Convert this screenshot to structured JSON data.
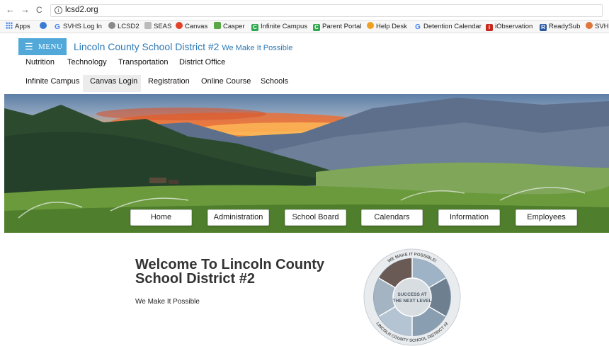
{
  "browser": {
    "back_glyph": "←",
    "forward_glyph": "→",
    "reload_glyph": "C",
    "info_glyph": "i",
    "url": "lcsd2.org",
    "bookmarks": [
      {
        "label": "Apps",
        "icon": "apps-grid-icon"
      },
      {
        "label": "",
        "icon": "blue-globe-icon",
        "color": "#3a7bd5"
      },
      {
        "label": "SVHS Log In",
        "icon": "google-icon",
        "glyph": "G",
        "color": "#4285f4"
      },
      {
        "label": "LCSD2",
        "icon": "lcsd2-icon",
        "color": "#8a8a8a"
      },
      {
        "label": "SEAS",
        "icon": "seas-icon",
        "color": "#bbbbbb"
      },
      {
        "label": "Canvas",
        "icon": "canvas-icon",
        "color": "#e4412a"
      },
      {
        "label": "Casper",
        "icon": "casper-icon",
        "color": "#59a845"
      },
      {
        "label": "Infinite Campus",
        "icon": "infinite-campus-icon",
        "glyph": "C",
        "color": "#2fa84f"
      },
      {
        "label": "Parent Portal",
        "icon": "parent-portal-icon",
        "glyph": "C",
        "color": "#2fa84f"
      },
      {
        "label": "Help Desk",
        "icon": "help-desk-icon",
        "color": "#f0a020"
      },
      {
        "label": "Detention Calendar",
        "icon": "google-icon",
        "glyph": "G",
        "color": "#4285f4"
      },
      {
        "label": "iObservation",
        "icon": "iobservation-icon",
        "glyph": "i",
        "color": "#c8281e"
      },
      {
        "label": "ReadySub",
        "icon": "readysub-icon",
        "glyph": "R",
        "color": "#2c5aa0"
      },
      {
        "label": "SVHS",
        "icon": "svhs-icon",
        "color": "#e0763a"
      }
    ]
  },
  "header": {
    "menu_icon_glyph": "☰",
    "menu_label": "MENU",
    "title": "Lincoln County School District #2",
    "tagline": "We Make It Possible"
  },
  "nav_row1": [
    "Nutrition",
    "Technology",
    "Transportation",
    "District Office"
  ],
  "nav_row2": [
    "Infinite Campus",
    "Canvas Login",
    "Registration",
    "Online Course",
    "Schools"
  ],
  "nav_row2_active": "Canvas Login",
  "hero_buttons": [
    "Home",
    "Administration",
    "School Board",
    "Calendars",
    "Information",
    "Employees"
  ],
  "welcome": {
    "title": "Welcome To Lincoln County School District #2",
    "subtitle": "We Make It Possible"
  },
  "seal": {
    "top_text": "WE MAKE IT POSSIBLE!",
    "bottom_text": "LINCOLN COUNTY SCHOOL DISTRICT #2",
    "center_text_1": "SUCCESS AT",
    "center_text_2": "THE NEXT LEVEL",
    "segments": [
      "STUDENT SAFETY",
      "SYSTEMS WHICH ALIGN",
      "VISIBLE TEACHING",
      "RELATIONSHIPS",
      "CURRICULUM",
      "RESPECT AND RELATIONSHIPS"
    ]
  },
  "colors": {
    "accent": "#52a9d9",
    "title_blue": "#2e7ab7"
  }
}
